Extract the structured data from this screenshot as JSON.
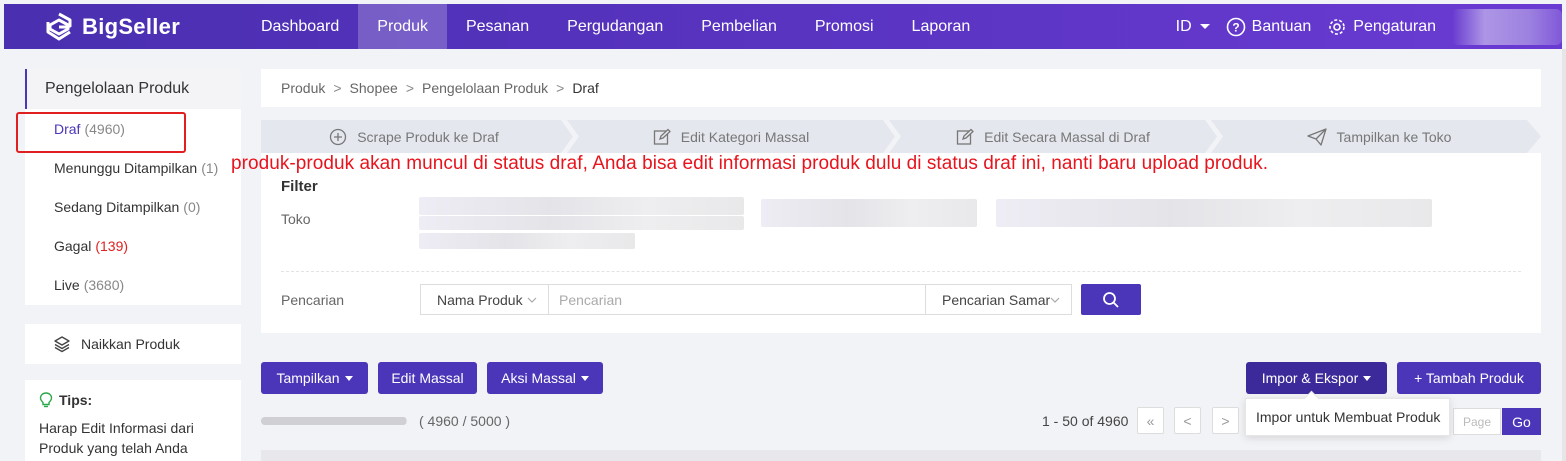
{
  "brand": {
    "name": "BigSeller",
    "accent": "#4b35b8",
    "annotation_color": "#e8141d"
  },
  "nav": {
    "items": [
      {
        "label": "Dashboard",
        "active": false
      },
      {
        "label": "Produk",
        "active": true
      },
      {
        "label": "Pesanan",
        "active": false
      },
      {
        "label": "Pergudangan",
        "active": false
      },
      {
        "label": "Pembelian",
        "active": false
      },
      {
        "label": "Promosi",
        "active": false
      },
      {
        "label": "Laporan",
        "active": false
      }
    ],
    "lang": "ID",
    "help": "Bantuan",
    "settings": "Pengaturan"
  },
  "sidebar": {
    "heading": "Pengelolaan Produk",
    "items": [
      {
        "label": "Draf",
        "count": "(4960)",
        "active": true
      },
      {
        "label": "Menunggu Ditampilkan",
        "count": "(1)"
      },
      {
        "label": "Sedang Ditampilkan",
        "count": "(0)"
      },
      {
        "label": "Gagal",
        "count": "(139)",
        "alert": true
      },
      {
        "label": "Live",
        "count": "(3680)"
      }
    ],
    "boost": "Naikkan Produk",
    "tips_title": "Tips:",
    "tips_text": "Harap Edit Informasi dari Produk yang telah Anda"
  },
  "breadcrumb": {
    "items": [
      "Produk",
      "Shopee",
      "Pengelolaan Produk"
    ],
    "sep": ">",
    "current": "Draf"
  },
  "steps": [
    "Scrape Produk ke Draf",
    "Edit Kategori Massal",
    "Edit Secara Massal di Draf",
    "Tampilkan ke Toko"
  ],
  "annotation": "produk-produk akan muncul di status draf, Anda bisa edit informasi produk dulu di status draf ini, nanti baru upload produk.",
  "filter": {
    "title": "Filter",
    "toko_label": "Toko",
    "search_label": "Pencarian",
    "field_select": "Nama Produk",
    "placeholder": "Pencarian",
    "mode_select": "Pencarian Samar"
  },
  "actions": {
    "tampilkan": "Tampilkan",
    "edit_massal": "Edit Massal",
    "aksi_massal": "Aksi Massal",
    "impor_ekspor": "Impor & Ekspor",
    "tambah": "+ Tambah Produk"
  },
  "quota": {
    "text": "( 4960 / 5000 )",
    "fraction": 0.992
  },
  "pager": {
    "range": "1 - 50 of 4960",
    "first": "«",
    "prev": "<",
    "next": ">",
    "page_placeholder": "Page",
    "go": "Go"
  },
  "dropdown": {
    "item": "Impor untuk Membuat Produk"
  }
}
